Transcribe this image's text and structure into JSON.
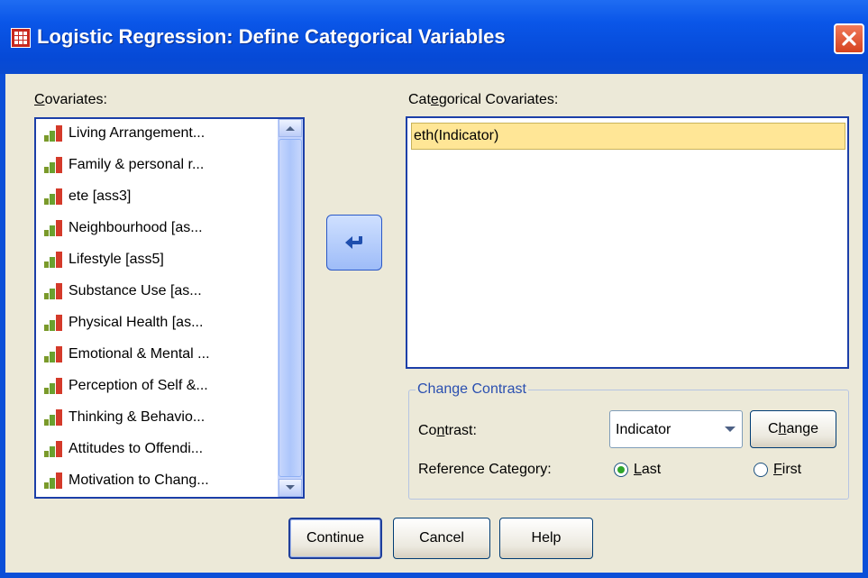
{
  "window": {
    "title": "Logistic Regression: Define Categorical Variables",
    "title_icon": "spss-table-icon",
    "close_icon": "close-icon"
  },
  "covariates": {
    "label_mnemonic": "C",
    "label_rest": "ovariates:",
    "items": [
      {
        "label": "Living Arrangement...",
        "icon": "ordinal-measure-icon"
      },
      {
        "label": "Family & personal r...",
        "icon": "ordinal-measure-icon"
      },
      {
        "label": "ete [ass3]",
        "icon": "ordinal-measure-icon"
      },
      {
        "label": "Neighbourhood [as...",
        "icon": "ordinal-measure-icon"
      },
      {
        "label": "Lifestyle [ass5]",
        "icon": "ordinal-measure-icon"
      },
      {
        "label": "Substance Use [as...",
        "icon": "ordinal-measure-icon"
      },
      {
        "label": "Physical Health [as...",
        "icon": "ordinal-measure-icon"
      },
      {
        "label": "Emotional & Mental ...",
        "icon": "ordinal-measure-icon"
      },
      {
        "label": "Perception of Self &...",
        "icon": "ordinal-measure-icon"
      },
      {
        "label": "Thinking & Behavio...",
        "icon": "ordinal-measure-icon"
      },
      {
        "label": "Attitudes to Offendi...",
        "icon": "ordinal-measure-icon"
      },
      {
        "label": "Motivation to Chang...",
        "icon": "ordinal-measure-icon"
      }
    ]
  },
  "move_button": {
    "icon": "move-left-arrow-icon"
  },
  "categorical": {
    "label_pre": "Cat",
    "label_mnemonic": "e",
    "label_rest": "gorical Covariates:",
    "items": [
      "eth(Indicator)"
    ]
  },
  "change_contrast": {
    "legend": "Change Contrast",
    "contrast_label_pre": "Co",
    "contrast_label_mnemonic": "n",
    "contrast_label_rest": "trast:",
    "contrast_value": "Indicator",
    "change_pre": "C",
    "change_mnemonic": "h",
    "change_rest": "ange",
    "reference_label": "Reference Category:",
    "last_mnemonic": "L",
    "last_rest": "ast",
    "first_mnemonic": "F",
    "first_rest": "irst",
    "selected": "Last"
  },
  "buttons": {
    "continue": "Continue",
    "cancel": "Cancel",
    "help": "Help"
  },
  "colors": {
    "titlebar": "#0a56e8",
    "dialog_bg": "#ece9d8",
    "selection": "#ffe696",
    "radio_selected": "#2fa52a"
  }
}
